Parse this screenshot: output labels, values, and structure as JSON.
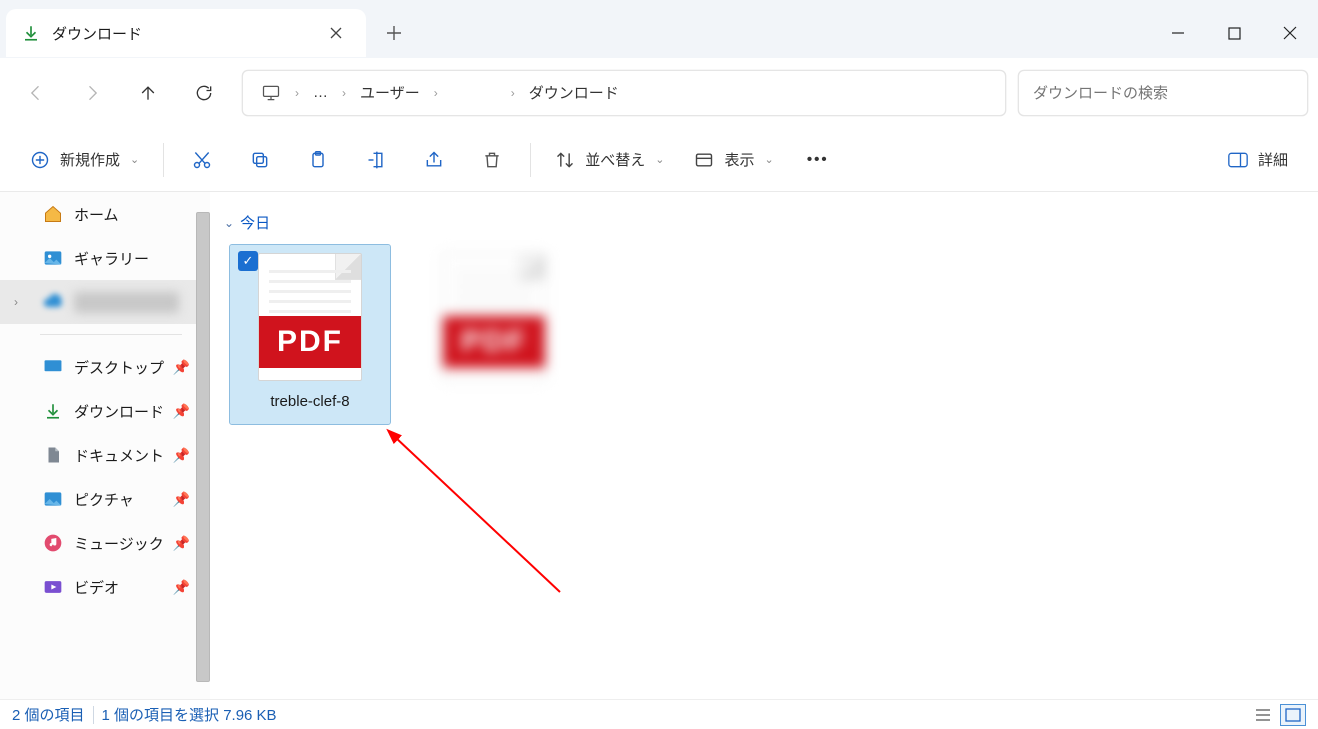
{
  "tab": {
    "title": "ダウンロード"
  },
  "breadcrumb": {
    "user_label": "ユーザー",
    "current_user_redacted": "　　　",
    "downloads": "ダウンロード"
  },
  "search": {
    "placeholder": "ダウンロードの検索"
  },
  "toolbar": {
    "new_label": "新規作成",
    "sort_label": "並べ替え",
    "view_label": "表示",
    "details_label": "詳細"
  },
  "sidebar": {
    "home": "ホーム",
    "gallery": "ギャラリー",
    "redacted_cloud": "　　　　　　　",
    "desktop": "デスクトップ",
    "downloads": "ダウンロード",
    "documents": "ドキュメント",
    "pictures": "ピクチャ",
    "music": "ミュージック",
    "videos": "ビデオ"
  },
  "content": {
    "group_today": "今日",
    "files": [
      {
        "name": "treble-clef-8",
        "type": "PDF",
        "selected": true
      },
      {
        "name": "　　　　",
        "type": "PDF",
        "selected": false,
        "blurred": true
      }
    ]
  },
  "status": {
    "item_count": "2 個の項目",
    "selection": "1 個の項目を選択 7.96 KB"
  }
}
